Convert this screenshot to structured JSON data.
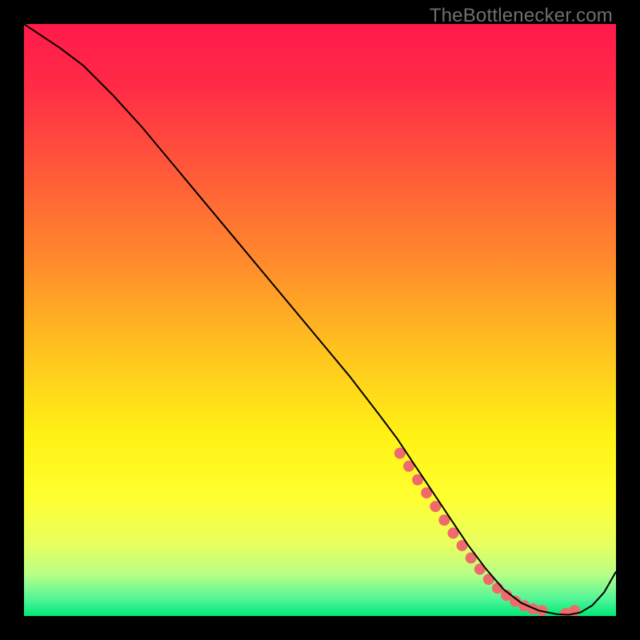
{
  "watermark": "TheBottlenecker.com",
  "chart_data": {
    "type": "line",
    "title": "",
    "xlabel": "",
    "ylabel": "",
    "xlim": [
      0,
      100
    ],
    "ylim": [
      0,
      100
    ],
    "grid": false,
    "legend": false,
    "background_gradient_stops": [
      {
        "offset": 0.0,
        "color": "#ff1a4b"
      },
      {
        "offset": 0.1,
        "color": "#ff2a46"
      },
      {
        "offset": 0.25,
        "color": "#ff5a39"
      },
      {
        "offset": 0.4,
        "color": "#ff8a2c"
      },
      {
        "offset": 0.55,
        "color": "#ffc21f"
      },
      {
        "offset": 0.7,
        "color": "#fff315"
      },
      {
        "offset": 0.8,
        "color": "#ffff30"
      },
      {
        "offset": 0.88,
        "color": "#e8ff60"
      },
      {
        "offset": 0.93,
        "color": "#b7ff86"
      },
      {
        "offset": 0.97,
        "color": "#55f598"
      },
      {
        "offset": 1.0,
        "color": "#00e878"
      }
    ],
    "series": [
      {
        "name": "curve",
        "color": "#000000",
        "stroke_width": 2,
        "x": [
          0,
          3,
          6,
          10,
          15,
          20,
          25,
          30,
          35,
          40,
          45,
          50,
          55,
          60,
          63,
          66,
          69,
          72,
          75,
          78,
          81,
          84,
          87,
          90,
          92,
          94,
          96,
          98,
          100
        ],
        "y": [
          100,
          98,
          96,
          93,
          88,
          82.5,
          76.5,
          70.5,
          64.5,
          58.5,
          52.5,
          46.5,
          40.5,
          34,
          30,
          25.5,
          21,
          16.5,
          12,
          8,
          4.5,
          2.2,
          0.9,
          0.3,
          0.2,
          0.6,
          1.8,
          4.0,
          7.5
        ]
      }
    ],
    "markers": {
      "name": "highlight-dots",
      "color": "#ef6a6a",
      "radius": 7,
      "x": [
        63.5,
        65.0,
        66.5,
        68.0,
        69.5,
        71.0,
        72.5,
        74.0,
        75.5,
        77.0,
        78.5,
        80.0,
        81.5,
        83.0,
        84.5,
        86.0,
        87.5,
        91.5,
        93.0
      ],
      "y": [
        27.5,
        25.3,
        23.0,
        20.8,
        18.5,
        16.2,
        14.0,
        11.9,
        9.8,
        7.9,
        6.2,
        4.7,
        3.5,
        2.5,
        1.7,
        1.2,
        0.9,
        0.4,
        0.9
      ]
    }
  }
}
